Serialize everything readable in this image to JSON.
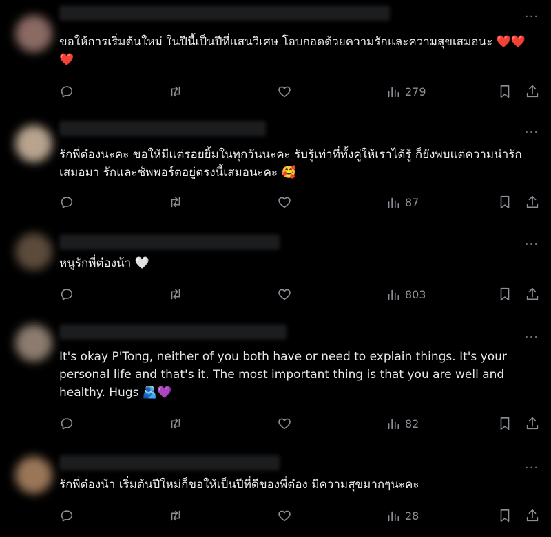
{
  "posts": [
    {
      "text": "ขอให้การเริ่มต้นใหม่ ในปีนี้เป็นปีที่แสนวิเศษ โอบกอดด้วยความรักและความสุขเสมอนะ ❤️❤️❤️",
      "views": "279",
      "avatar_color": "#8a6a62"
    },
    {
      "text": "รักพี่ต๋องนะคะ ขอให้มีแต่รอยยิ้มในทุกวันนะคะ รับรู้เท่าที่ทั้งคู่ให้เราได้รู้ ก็ยังพบแต่ความน่ารักเสมอมา รักและซัพพอร์ตอยู่ตรงนี้เสมอนะคะ 🥰",
      "views": "87",
      "avatar_color": "#b7a38e"
    },
    {
      "text": "หนูรักพี่ต๋องน้า 🤍",
      "views": "803",
      "avatar_color": "#5c4b3b"
    },
    {
      "text": "It's okay P'Tong, neither of you both have or need to explain things. It's your personal life and that's it. The most important thing is that you are well and healthy. Hugs 🫂💜",
      "views": "82",
      "avatar_color": "#8c7b6e"
    },
    {
      "text": "รักพี่ต๋องน้า เริ่มต้นปีใหม่ก็ขอให้เป็นปีที่ดีของพี่ต๋อง มีความสุขมากๆนะคะ",
      "views": "28",
      "avatar_color": "#9a7658"
    }
  ],
  "icons": {
    "reply": "reply-icon",
    "repost": "repost-icon",
    "like": "heart-icon",
    "views": "views-icon",
    "bookmark": "bookmark-icon",
    "share": "share-icon",
    "more": "more-icon"
  },
  "more_label": "···"
}
